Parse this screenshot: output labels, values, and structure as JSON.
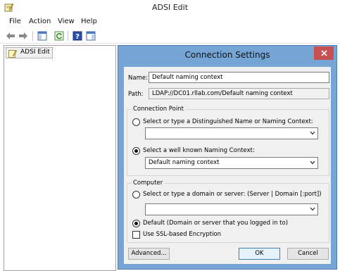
{
  "window": {
    "title": "ADSI Edit"
  },
  "menu": {
    "items": [
      "File",
      "Action",
      "View",
      "Help"
    ]
  },
  "tree": {
    "root": "ADSI Edit"
  },
  "dialog": {
    "title": "Connection Settings",
    "name_label": "Name:",
    "name_value": "Default naming context",
    "path_label": "Path:",
    "path_value": "LDAP://DC01.rllab.com/Default naming context",
    "connection_point": {
      "title": "Connection Point",
      "option_dn": "Select or type a Distinguished Name or Naming Context:",
      "dn_value": "",
      "option_known": "Select a well known Naming Context:",
      "known_value": "Default naming context"
    },
    "computer": {
      "title": "Computer",
      "option_server": "Select or type a domain or server: (Server | Domain [:port])",
      "server_value": "",
      "option_default": "Default (Domain or server that you logged in to)",
      "ssl_label": "Use SSL-based Encryption",
      "ssl_checked": false
    },
    "buttons": {
      "advanced": "Advanced...",
      "ok": "OK",
      "cancel": "Cancel"
    }
  }
}
